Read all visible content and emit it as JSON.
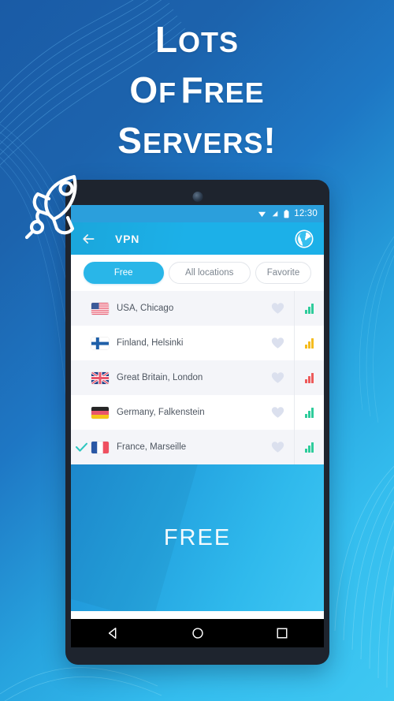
{
  "promo": {
    "headline_lines": [
      "Lots",
      "of Free",
      "Servers!"
    ],
    "background_colors": {
      "top_left": "#1a5ba6",
      "bottom_right": "#3fc8f2"
    },
    "rocket_icon": "rocket-icon"
  },
  "phone": {
    "statusbar": {
      "clock": "12:30",
      "icons": [
        "wifi-icon",
        "cellular-signal-icon",
        "battery-icon"
      ],
      "background": "#2b9fdc"
    },
    "toolbar": {
      "back_icon": "back-arrow-icon",
      "title": "VPN",
      "action_icon": "globe-icon",
      "background": "#1cb0e8"
    },
    "filters": {
      "chips": [
        {
          "label": "Free",
          "active": true
        },
        {
          "label": "All locations",
          "active": false
        },
        {
          "label": "Favorite",
          "active": false
        }
      ],
      "active_color": "#29b6e8"
    },
    "servers": [
      {
        "name": "USA, Chicago",
        "flag": "flag-us",
        "selected": false,
        "favorite": false,
        "signal_color": "#2ecc9b",
        "signal_level": 3
      },
      {
        "name": "Finland, Helsinki",
        "flag": "flag-fi",
        "selected": false,
        "favorite": false,
        "signal_color": "#f5bc1e",
        "signal_level": 3
      },
      {
        "name": "Great Britain, London",
        "flag": "flag-gb",
        "selected": false,
        "favorite": false,
        "signal_color": "#ed5a5a",
        "signal_level": 3
      },
      {
        "name": "Germany, Falkenstein",
        "flag": "flag-de",
        "selected": false,
        "favorite": false,
        "signal_color": "#2ecc9b",
        "signal_level": 3
      },
      {
        "name": "France, Marseille",
        "flag": "flag-fr",
        "selected": true,
        "favorite": false,
        "signal_color": "#2ecc9b",
        "signal_level": 3
      }
    ],
    "plan_panel": {
      "label": "FREE"
    },
    "navbar": {
      "buttons": [
        "back-nav-icon",
        "home-nav-icon",
        "recents-nav-icon"
      ]
    }
  }
}
